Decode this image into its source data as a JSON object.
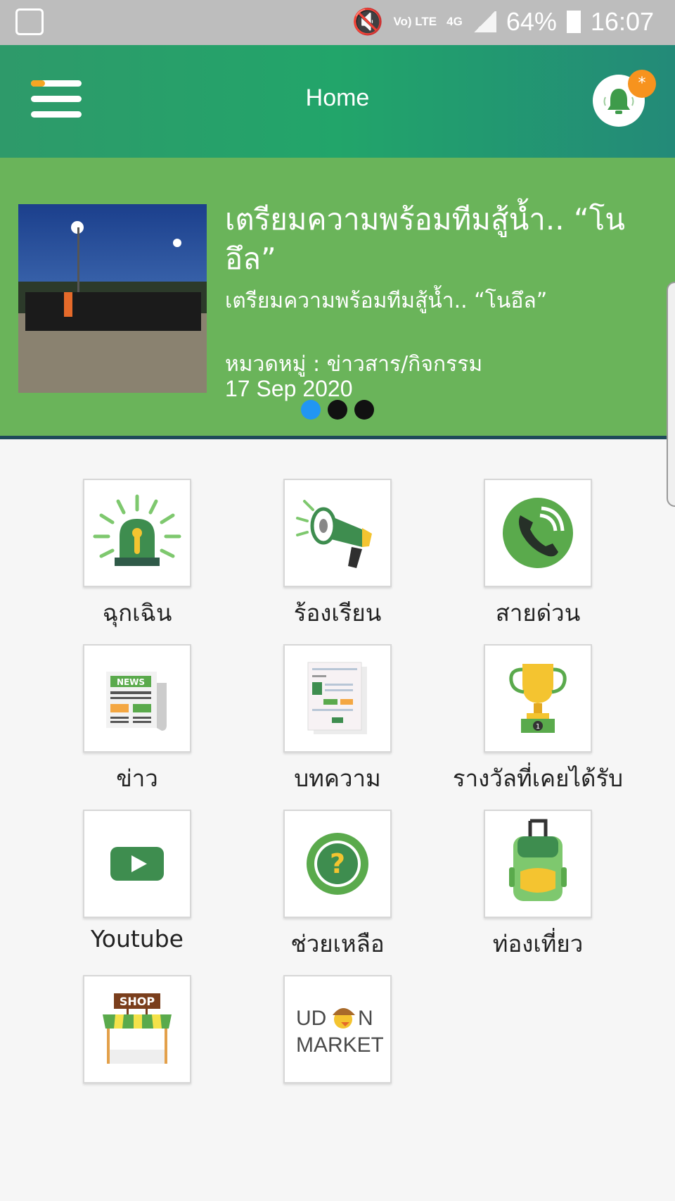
{
  "status": {
    "volte": "Vo) LTE",
    "network": "4G",
    "battery": "64%",
    "time": "16:07"
  },
  "header": {
    "title": "Home",
    "badge": "*"
  },
  "banner": {
    "headline": "เตรียมความพร้อมทีมสู้น้ำ.. “โนอึล”",
    "subtitle": "เตรียมความพร้อมทีมสู้น้ำ.. “โนอึล”",
    "category": "หมวดหมู่ : ข่าวสาร/กิจกรรม",
    "date": "17 Sep 2020",
    "pages": 3,
    "active_page": 1
  },
  "menu": [
    {
      "label": "ฉุกเฉิน",
      "icon": "siren-icon"
    },
    {
      "label": "ร้องเรียน",
      "icon": "megaphone-icon"
    },
    {
      "label": "สายด่วน",
      "icon": "phone-icon"
    },
    {
      "label": "ข่าว",
      "icon": "newspaper-icon"
    },
    {
      "label": "บทความ",
      "icon": "article-icon"
    },
    {
      "label": "รางวัลที่เคยได้รับ",
      "icon": "trophy-icon"
    },
    {
      "label": "Youtube",
      "icon": "youtube-icon"
    },
    {
      "label": "ช่วยเหลือ",
      "icon": "help-icon"
    },
    {
      "label": "ท่องเที่ยว",
      "icon": "luggage-icon"
    },
    {
      "label": "",
      "icon": "shop-icon",
      "image_text": "SHOP"
    },
    {
      "label": "",
      "icon": "udon-market-logo",
      "image_text": "UDON MARKET"
    }
  ],
  "colors": {
    "appbar": "#22a56a",
    "banner": "#6ab45a",
    "accent": "#f7931e",
    "dot_active": "#2196f3",
    "icon_green": "#3e8d4f"
  }
}
